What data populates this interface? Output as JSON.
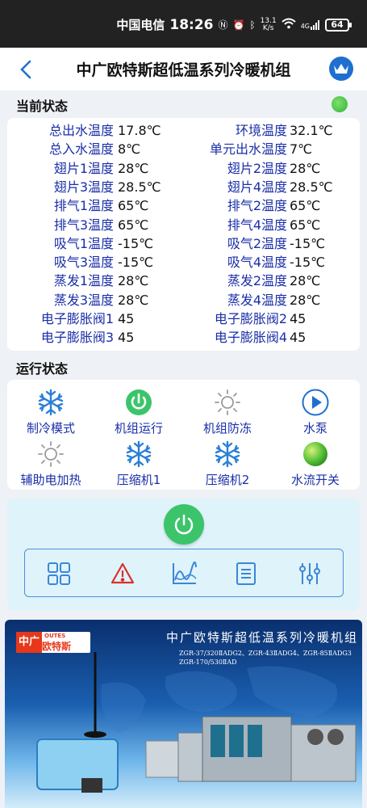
{
  "status_bar": {
    "carrier": "中国电信",
    "time": "18:26",
    "net_speed_top": "13.1",
    "net_speed_unit": "K/s",
    "signal_label": "4G",
    "battery": "64"
  },
  "nav": {
    "title": "中广欧特斯超低温系列冷暖机组"
  },
  "current_status": {
    "title": "当前状态",
    "rows": [
      {
        "l_label": "总出水温度",
        "l_value": "17.8℃",
        "r_label": "环境温度",
        "r_value": "32.1℃"
      },
      {
        "l_label": "总入水温度",
        "l_value": "8℃",
        "r_label": "单元出水温度",
        "r_value": "7℃"
      },
      {
        "l_label": "翅片1温度",
        "l_value": "28℃",
        "r_label": "翅片2温度",
        "r_value": "28℃"
      },
      {
        "l_label": "翅片3温度",
        "l_value": "28.5℃",
        "r_label": "翅片4温度",
        "r_value": "28.5℃"
      },
      {
        "l_label": "排气1温度",
        "l_value": "65℃",
        "r_label": "排气2温度",
        "r_value": "65℃"
      },
      {
        "l_label": "排气3温度",
        "l_value": "65℃",
        "r_label": "排气4温度",
        "r_value": "65℃"
      },
      {
        "l_label": "吸气1温度",
        "l_value": "-15℃",
        "r_label": "吸气2温度",
        "r_value": "-15℃"
      },
      {
        "l_label": "吸气3温度",
        "l_value": "-15℃",
        "r_label": "吸气4温度",
        "r_value": "-15℃"
      },
      {
        "l_label": "蒸发1温度",
        "l_value": "28℃",
        "r_label": "蒸发2温度",
        "r_value": "28℃"
      },
      {
        "l_label": "蒸发3温度",
        "l_value": "28℃",
        "r_label": "蒸发4温度",
        "r_value": "28℃"
      },
      {
        "l_label": "电子膨胀阀1",
        "l_value": "45",
        "r_label": "电子膨胀阀2",
        "r_value": "45"
      },
      {
        "l_label": "电子膨胀阀3",
        "l_value": "45",
        "r_label": "电子膨胀阀4",
        "r_value": "45"
      }
    ]
  },
  "run_status": {
    "title": "运行状态",
    "items": [
      {
        "label": "制冷模式",
        "icon": "snowflake-icon"
      },
      {
        "label": "机组运行",
        "icon": "power-icon"
      },
      {
        "label": "机组防冻",
        "icon": "sun-icon"
      },
      {
        "label": "水泵",
        "icon": "play-icon"
      },
      {
        "label": "辅助电加热",
        "icon": "sun-icon"
      },
      {
        "label": "压缩机1",
        "icon": "snowflake-icon"
      },
      {
        "label": "压缩机2",
        "icon": "snowflake-icon"
      },
      {
        "label": "水流开关",
        "icon": "green-ball-icon"
      }
    ]
  },
  "toolbar": {
    "items": [
      "grid-icon",
      "warning-icon",
      "chart-icon",
      "list-icon",
      "settings-sliders-icon"
    ]
  },
  "banner": {
    "logo_cn": "中广",
    "logo_en": "OUTES",
    "logo_cn2": "欧特斯",
    "title": "中广欧特斯超低温系列冷暖机组",
    "models_line1": "ZGR-37/320ⅡADG2、ZGR-43ⅡADG4、ZGR-85ⅡADG3",
    "models_line2": "ZGR-170/530ⅡAD"
  },
  "colors": {
    "label_blue": "#1a2fa8",
    "accent_blue": "#1f6fd1",
    "power_green": "#3cc46b",
    "warning_red": "#d9302c"
  }
}
